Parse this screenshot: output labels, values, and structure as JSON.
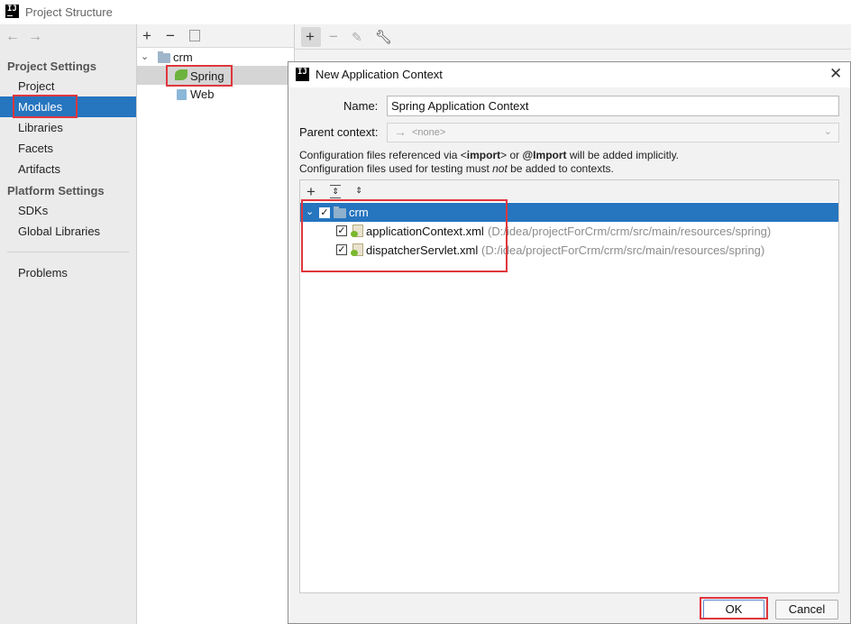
{
  "window": {
    "title": "Project Structure",
    "logo_text": "IJ"
  },
  "nav": {
    "back_icon": "arrow-left-icon",
    "forward_icon": "arrow-right-icon"
  },
  "sidebar": {
    "project_settings_header": "Project Settings",
    "platform_settings_header": "Platform Settings",
    "items": {
      "project": "Project",
      "modules": "Modules",
      "libraries": "Libraries",
      "facets": "Facets",
      "artifacts": "Artifacts",
      "sdks": "SDKs",
      "global_libraries": "Global Libraries",
      "problems": "Problems"
    },
    "selected": "Modules",
    "selected_color": "#2675bf"
  },
  "module_tree": {
    "toolbar": {
      "add": "+",
      "remove": "−",
      "copy_icon": "copy-icon"
    },
    "root": "crm",
    "children": [
      "Spring",
      "Web"
    ]
  },
  "facet_toolbar": {
    "add": "+",
    "remove": "−",
    "edit_icon": "pencil-icon",
    "wrench_icon": "wrench-icon"
  },
  "dialog": {
    "title": "New Application Context",
    "name_label": "Name:",
    "name_value": "Spring Application Context",
    "parent_label": "Parent context:",
    "parent_value": "<none>",
    "info_line1_a": "Configuration files referenced via <",
    "info_line1_b": "import",
    "info_line1_c": "> or ",
    "info_line1_d": "@Import",
    "info_line1_e": " will be added implicitly.",
    "info_line2_a": "Configuration files used for testing must ",
    "info_line2_b": "not",
    "info_line2_c": " be added to contexts.",
    "file_toolbar": {
      "add": "+",
      "expand_icon": "expand-all-icon",
      "collapse_icon": "collapse-all-icon"
    },
    "tree": {
      "module": "crm",
      "files": [
        {
          "name": "applicationContext.xml",
          "path": "(D:/idea/projectForCrm/crm/src/main/resources/spring)",
          "checked": true
        },
        {
          "name": "dispatcherServlet.xml",
          "path": "(D:/idea/projectForCrm/crm/src/main/resources/spring)",
          "checked": true
        }
      ]
    },
    "ok_label": "OK",
    "cancel_label": "Cancel"
  },
  "colors": {
    "highlight_box": "#e0363d",
    "selection": "#2675bf"
  }
}
